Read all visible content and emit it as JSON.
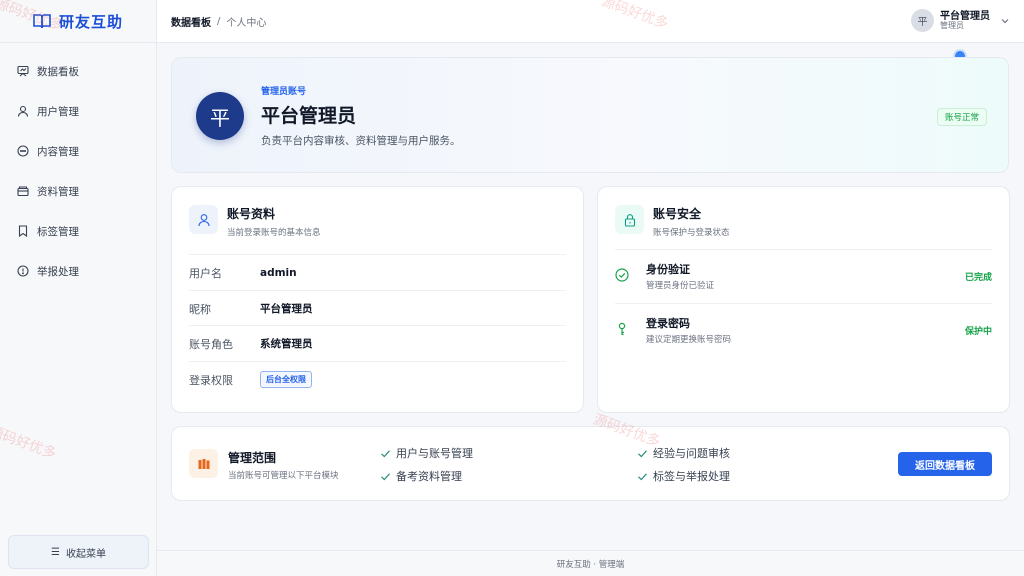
{
  "brand": {
    "name": "研友互助"
  },
  "sidebar": {
    "items": [
      {
        "label": "数据看板",
        "icon": "dashboard-icon"
      },
      {
        "label": "用户管理",
        "icon": "user-icon"
      },
      {
        "label": "内容管理",
        "icon": "message-icon"
      },
      {
        "label": "资料管理",
        "icon": "folder-icon"
      },
      {
        "label": "标签管理",
        "icon": "bookmark-icon"
      },
      {
        "label": "举报处理",
        "icon": "alert-icon"
      }
    ],
    "collapse_label": "收起菜单"
  },
  "header": {
    "breadcrumb": {
      "parent": "数据看板",
      "separator": "/",
      "current": "个人中心"
    },
    "user": {
      "avatar_char": "平",
      "name": "平台管理员",
      "role": "管理员"
    }
  },
  "profile": {
    "avatar_char": "平",
    "tag": "管理员账号",
    "name": "平台管理员",
    "desc": "负责平台内容审核、资料管理与用户服务。",
    "status": "账号正常"
  },
  "account_info": {
    "title": "账号资料",
    "subtitle": "当前登录账号的基本信息",
    "rows": [
      {
        "key": "用户名",
        "value": "admin"
      },
      {
        "key": "昵称",
        "value": "平台管理员"
      },
      {
        "key": "账号角色",
        "value": "系统管理员"
      },
      {
        "key": "登录权限",
        "value": "后台全权限"
      }
    ]
  },
  "account_security": {
    "title": "账号安全",
    "subtitle": "账号保护与登录状态",
    "items": [
      {
        "title": "身份验证",
        "sub": "管理员身份已验证",
        "state": "已完成"
      },
      {
        "title": "登录密码",
        "sub": "建议定期更换账号密码",
        "state": "保护中"
      }
    ]
  },
  "scope": {
    "title": "管理范围",
    "subtitle": "当前账号可管理以下平台模块",
    "items": [
      "用户与账号管理",
      "经验与问题审核",
      "备考资料管理",
      "标签与举报处理"
    ],
    "button": "返回数据看板"
  },
  "footer": {
    "text": "研友互助 · 管理端"
  },
  "watermark": "源码好优多",
  "colors": {
    "accent": "#2563eb",
    "avatar_bg": "#1e3a8a",
    "success": "#16a34a"
  }
}
